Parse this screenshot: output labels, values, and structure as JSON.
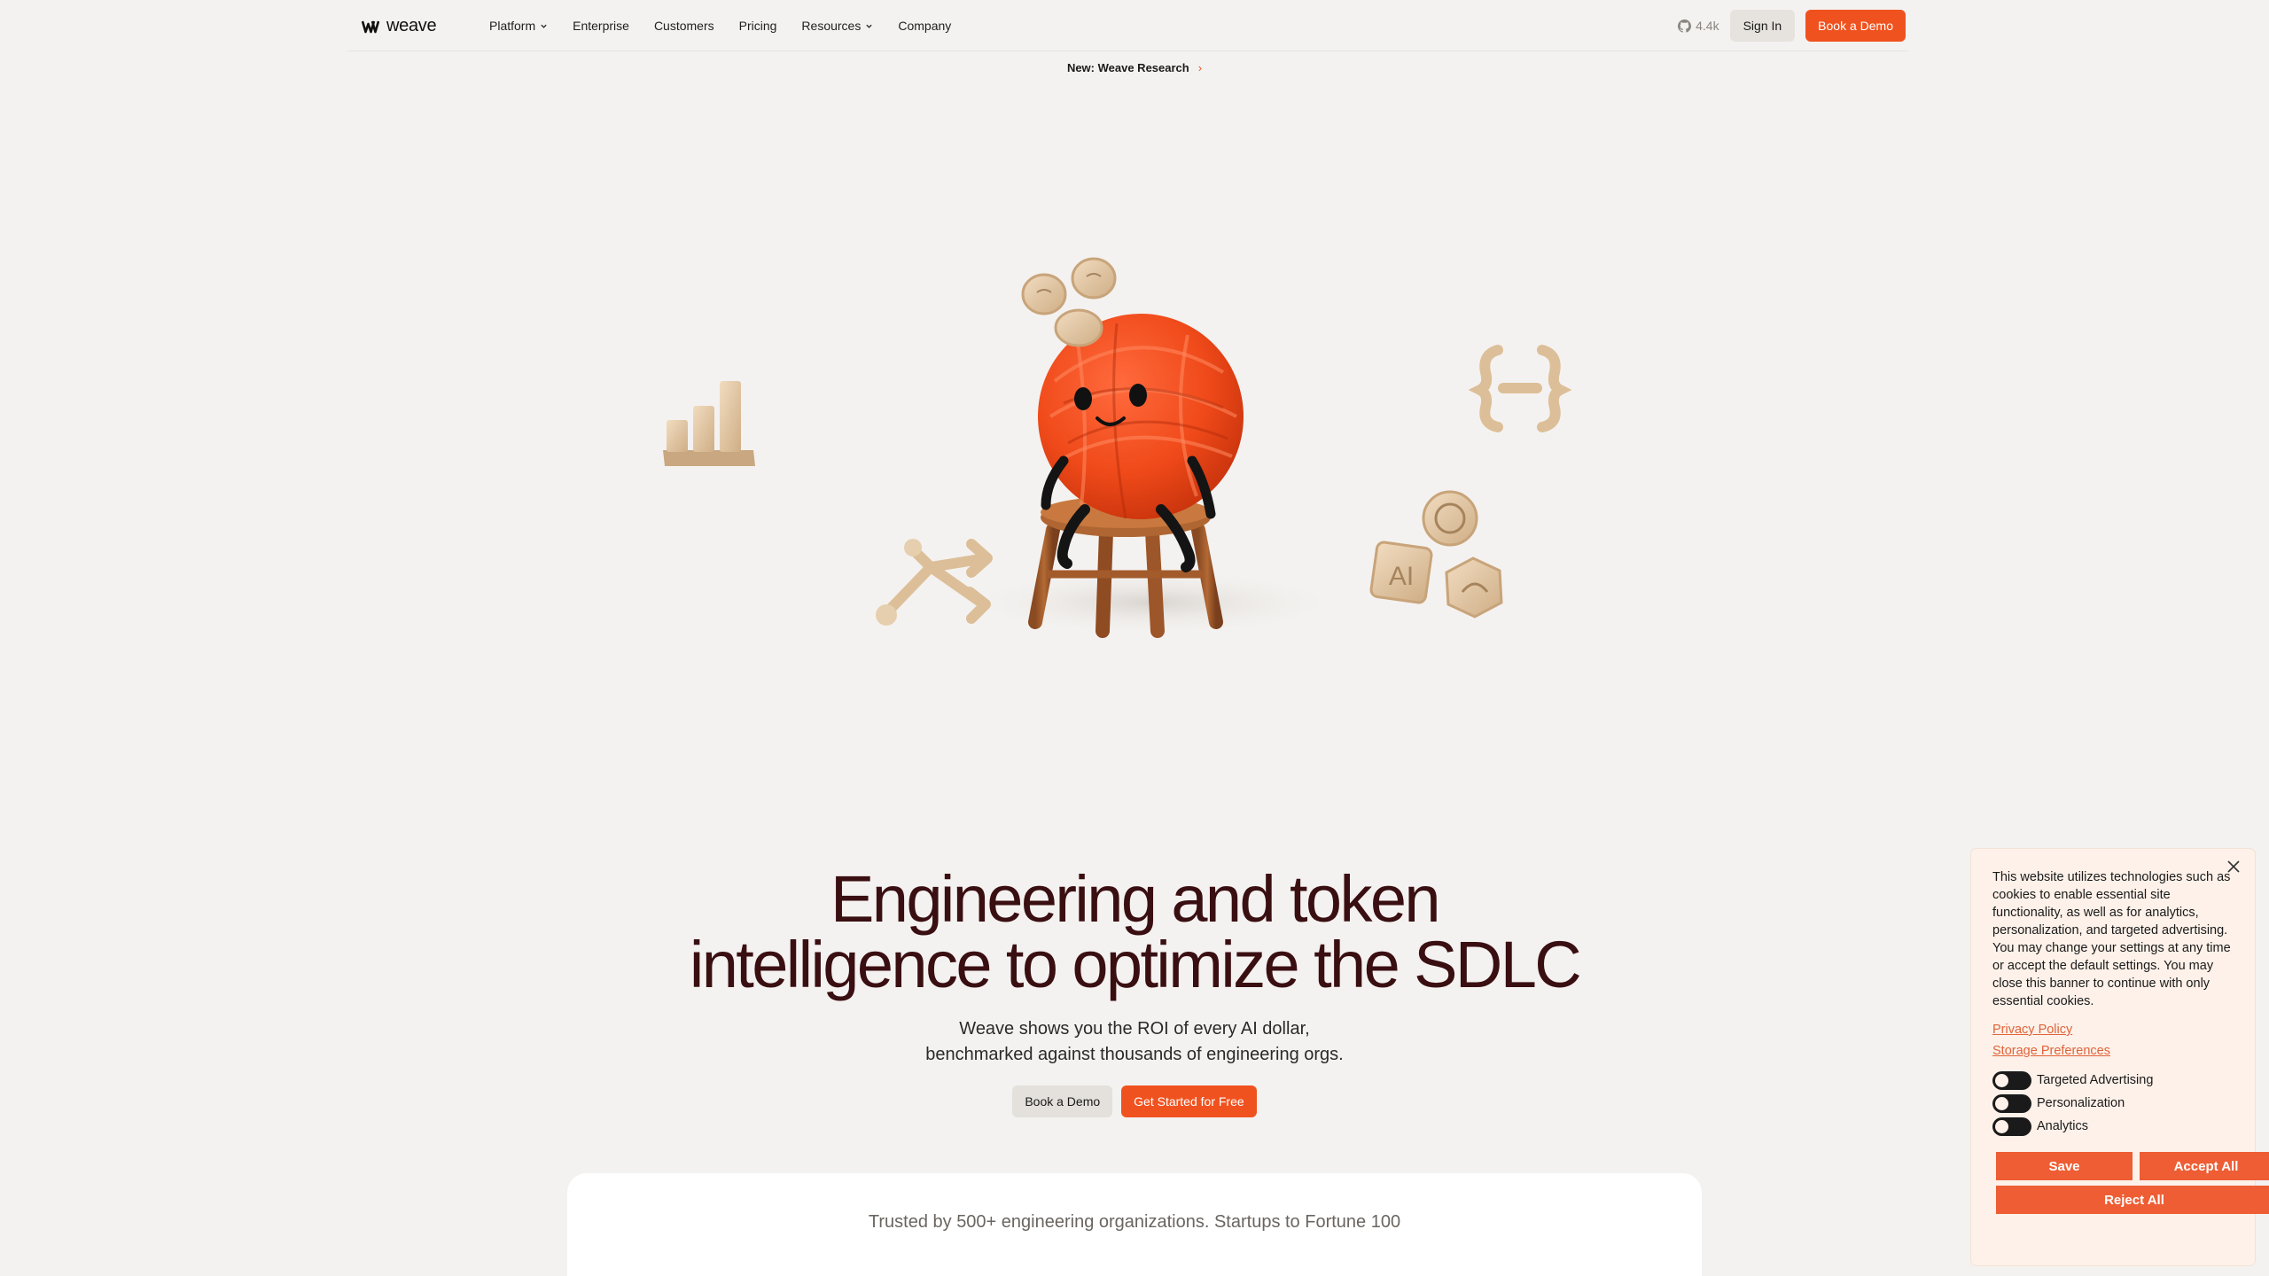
{
  "brand": {
    "name": "weave",
    "accent": "#f0521f",
    "headline_color": "#3a0f12"
  },
  "nav": {
    "links": [
      {
        "label": "Platform",
        "has_menu": true
      },
      {
        "label": "Enterprise",
        "has_menu": false
      },
      {
        "label": "Customers",
        "has_menu": false
      },
      {
        "label": "Pricing",
        "has_menu": false
      },
      {
        "label": "Resources",
        "has_menu": true
      },
      {
        "label": "Company",
        "has_menu": false
      }
    ],
    "github_stars": "4.4k",
    "sign_in": "Sign In",
    "book_demo": "Book a Demo"
  },
  "announcement": {
    "text": "New: Weave Research",
    "arrow": "›"
  },
  "hero": {
    "illustration": {
      "art_label": "AI"
    },
    "headline_line1": "Engineering and token",
    "headline_line2": "intelligence to optimize the SDLC",
    "sub_line1": "Weave shows you the ROI of every AI dollar,",
    "sub_line2": "benchmarked against thousands of engineering orgs.",
    "cta_secondary": "Book a Demo",
    "cta_primary": "Get Started for Free"
  },
  "trusted": {
    "text": "Trusted by 500+ engineering organizations. Startups to Fortune 100"
  },
  "cookie_banner": {
    "body": "This website utilizes technologies such as cookies to enable essential site functionality, as well as for analytics, personalization, and targeted advertising. You may change your settings at any time or accept the default settings. You may close this banner to continue with only essential cookies.",
    "privacy_policy": "Privacy Policy",
    "storage_preferences": "Storage Preferences",
    "toggles": [
      {
        "label": "Targeted Advertising",
        "on": false
      },
      {
        "label": "Personalization",
        "on": false
      },
      {
        "label": "Analytics",
        "on": false
      }
    ],
    "save": "Save",
    "accept_all": "Accept All",
    "reject_all": "Reject All"
  }
}
